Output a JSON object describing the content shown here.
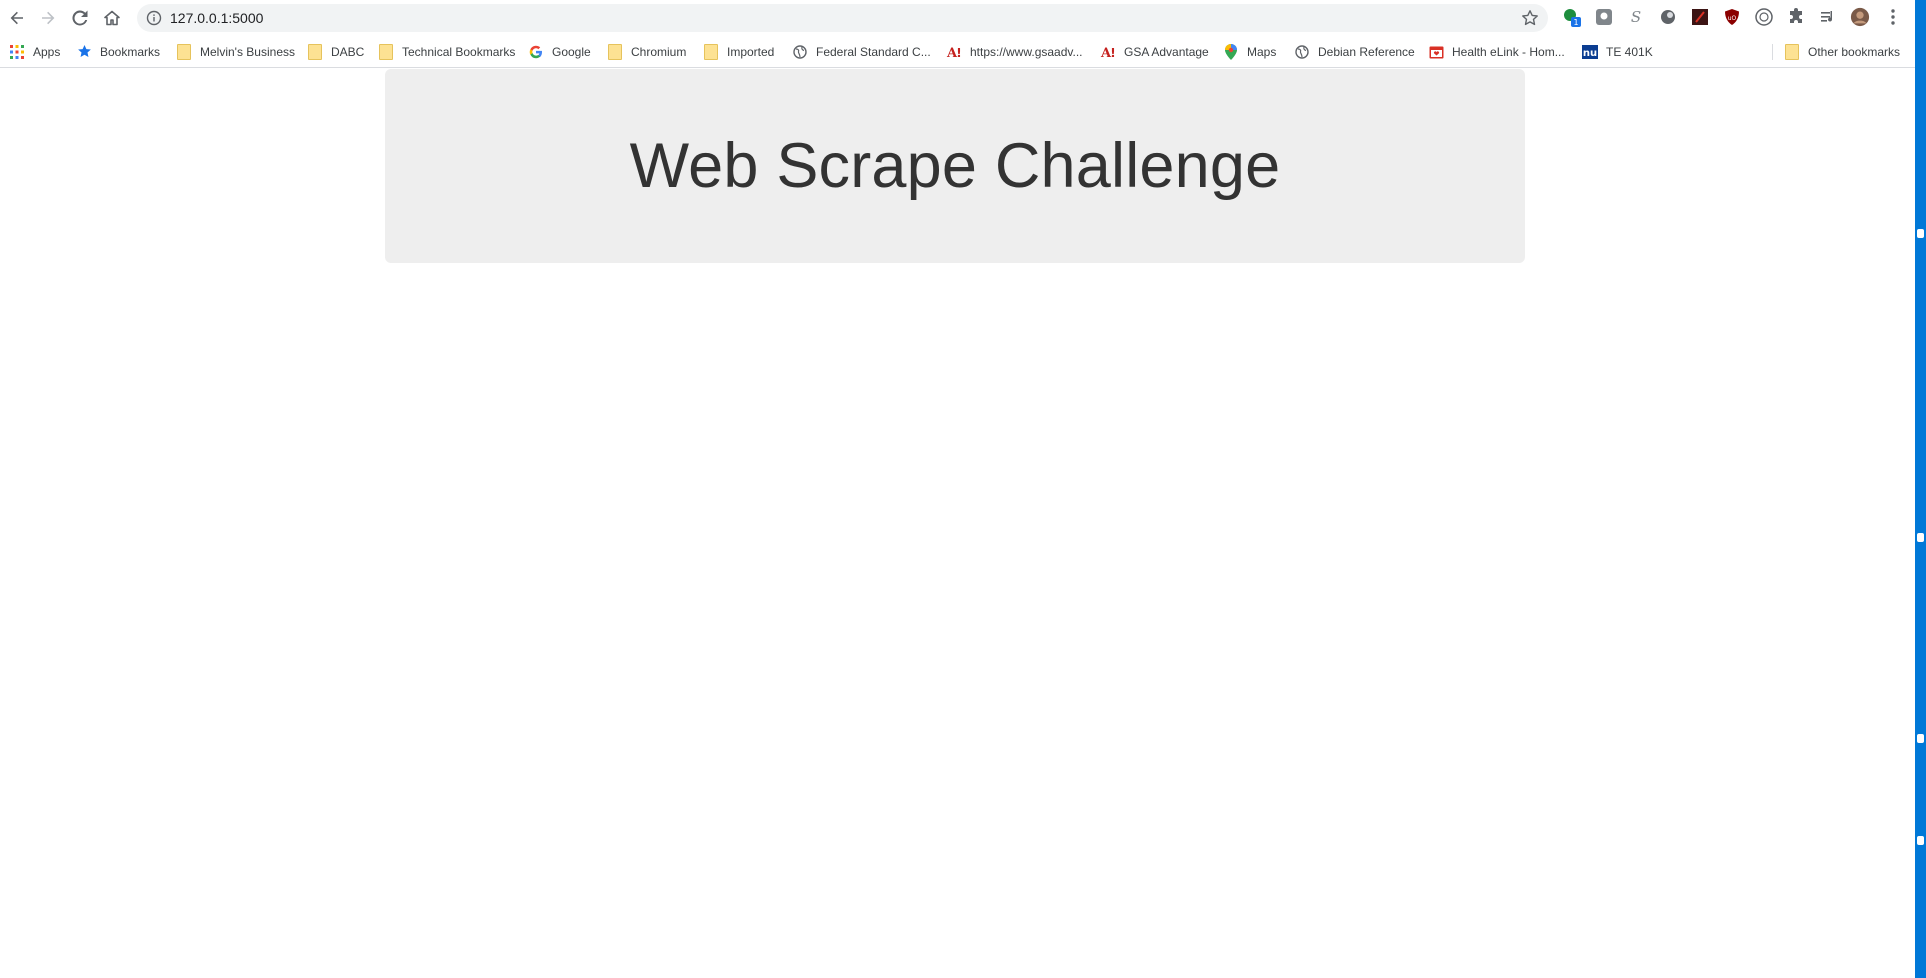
{
  "browser": {
    "url": "127.0.0.1:5000",
    "nav": {
      "back_icon": "arrow-left-icon",
      "forward_icon": "arrow-right-icon",
      "reload_icon": "reload-icon",
      "home_icon": "home-icon"
    },
    "extensions": [
      "green-dot-extension-icon",
      "grey-square-extension-icon",
      "s-extension-icon",
      "grey-circle-extension-icon",
      "red-square-extension-icon",
      "ublock-shield-icon",
      "circle-outline-extension-icon",
      "puzzle-icon",
      "media-queue-icon",
      "profile-avatar",
      "kebab-menu-icon"
    ],
    "extension_badge": "1"
  },
  "bookmarks": {
    "items": [
      {
        "label": "Apps",
        "icon": "apps-grid-icon"
      },
      {
        "label": "Bookmarks",
        "icon": "blue-star-icon"
      },
      {
        "label": "Melvin's Business",
        "icon": "folder-icon"
      },
      {
        "label": "DABC",
        "icon": "folder-icon"
      },
      {
        "label": "Technical Bookmarks",
        "icon": "folder-icon"
      },
      {
        "label": "Google",
        "icon": "google-g-icon"
      },
      {
        "label": "Chromium",
        "icon": "folder-icon"
      },
      {
        "label": "Imported",
        "icon": "folder-icon"
      },
      {
        "label": "Federal Standard C...",
        "icon": "globe-icon"
      },
      {
        "label": "https://www.gsaadv...",
        "icon": "gsa-a-icon"
      },
      {
        "label": "GSA Advantage",
        "icon": "gsa-a-icon"
      },
      {
        "label": "Maps",
        "icon": "maps-pin-icon"
      },
      {
        "label": "Debian Reference",
        "icon": "globe-icon"
      },
      {
        "label": "Health eLink - Hom...",
        "icon": "red-calendar-icon"
      },
      {
        "label": "TE 401K",
        "icon": "nu-icon"
      }
    ],
    "other": {
      "label": "Other bookmarks",
      "icon": "folder-icon"
    }
  },
  "page": {
    "heading": "Web Scrape Challenge"
  },
  "colors": {
    "jumbotron_bg": "#eeeeee",
    "heading": "#333333",
    "omnibox_bg": "#f1f3f4",
    "right_edge": "#0078d7"
  }
}
